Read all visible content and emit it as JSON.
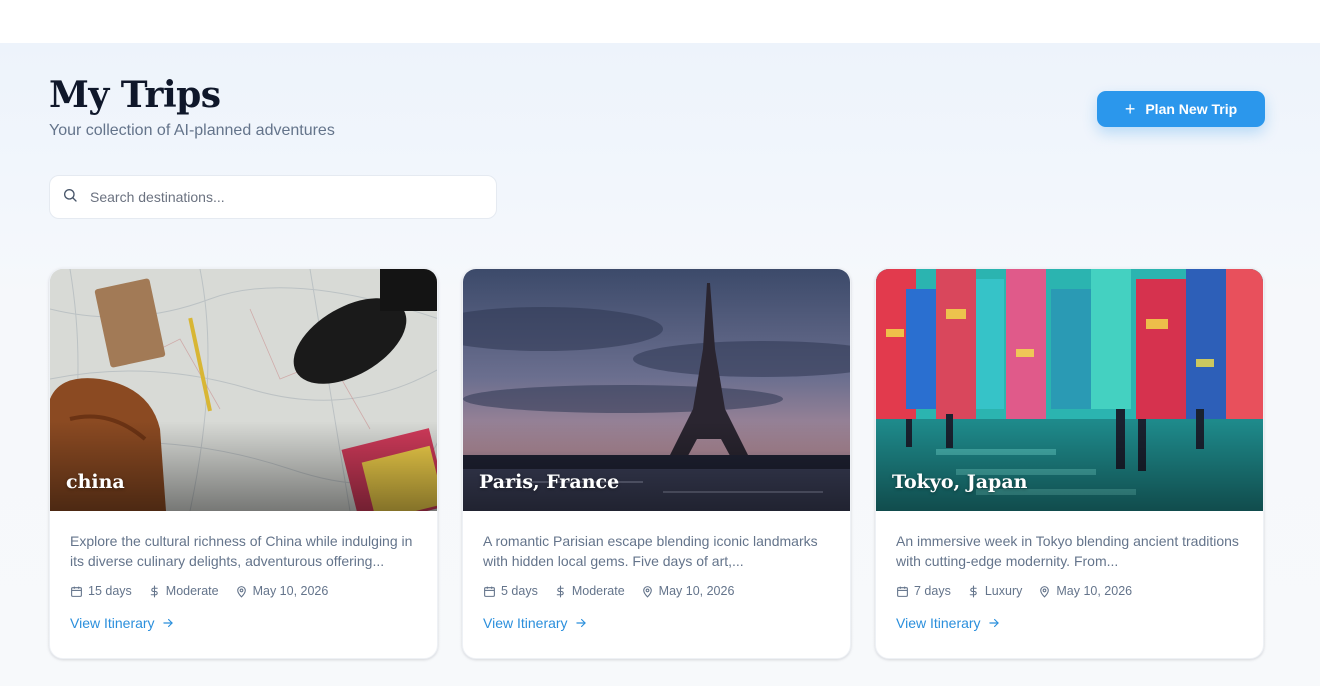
{
  "header": {
    "title": "My Trips",
    "subtitle": "Your collection of AI-planned adventures",
    "plan_button_label": "Plan New Trip"
  },
  "search": {
    "placeholder": "Search destinations...",
    "value": ""
  },
  "colors": {
    "accent": "#2b97ec",
    "link": "#2b8fdc",
    "title": "#0f172a",
    "muted": "#64748b"
  },
  "trips": [
    {
      "destination": "china",
      "description": "Explore the cultural richness of China while indulging in its diverse culinary delights, adventurous offering...",
      "duration": "15 days",
      "budget": "Moderate",
      "date": "May 10, 2026",
      "link_label": "View Itinerary"
    },
    {
      "destination": "Paris, France",
      "description": "A romantic Parisian escape blending iconic landmarks with hidden local gems. Five days of art,...",
      "duration": "5 days",
      "budget": "Moderate",
      "date": "May 10, 2026",
      "link_label": "View Itinerary"
    },
    {
      "destination": "Tokyo, Japan",
      "description": "An immersive week in Tokyo blending ancient traditions with cutting-edge modernity. From...",
      "duration": "7 days",
      "budget": "Luxury",
      "date": "May 10, 2026",
      "link_label": "View Itinerary"
    }
  ]
}
